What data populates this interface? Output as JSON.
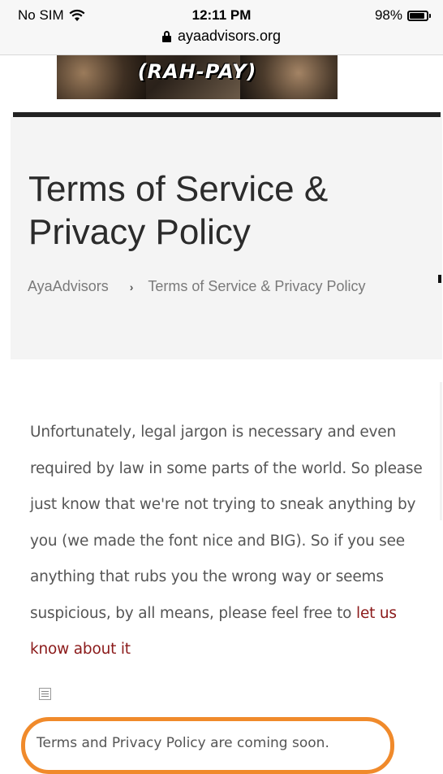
{
  "status_bar": {
    "carrier": "No SIM",
    "time": "12:11 PM",
    "battery": "98%"
  },
  "url_bar": {
    "domain": "ayaadvisors.org"
  },
  "banner": {
    "text": "(RAH-PAY)"
  },
  "header": {
    "title": "Terms of Service & Privacy Policy",
    "breadcrumb": {
      "home": "AyaAdvisors",
      "separator": "›",
      "current": "Terms of Service & Privacy Policy"
    }
  },
  "content": {
    "intro": "Unfortunately, legal jargon is necessary and even required by law in some parts of the world. So please just know that we're not trying to sneak anything by you (we made the font nice and BIG). So if you see anything that rubs you the wrong way or seems suspicious, by all means, please feel free to",
    "link_text": "let us know about it",
    "notice": "Terms and Privacy Policy are coming soon."
  },
  "colors": {
    "highlight": "#f08a2b",
    "link": "#8b1a1a",
    "title": "#2b2b2b"
  }
}
